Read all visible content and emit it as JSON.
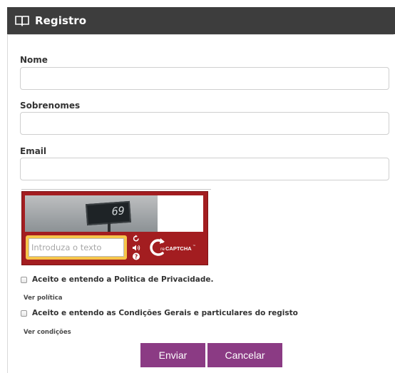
{
  "header": {
    "title": "Registro",
    "icon": "book-icon"
  },
  "form": {
    "nome_label": "Nome",
    "nome_value": "",
    "sobrenomes_label": "Sobrenomes",
    "sobrenomes_value": "",
    "email_label": "Email",
    "email_value": ""
  },
  "captcha": {
    "challenge_text": "69",
    "placeholder": "Introduza o texto",
    "value": "",
    "logo_text": "CAPTCHA",
    "logo_prefix": "re",
    "logo_tm": "™",
    "tools": [
      "refresh-icon",
      "audio-icon",
      "help-icon"
    ],
    "brand_color": "#a31d20",
    "input_frame_color": "#f6c54a"
  },
  "agreements": [
    {
      "label": "Aceito e entendo a Politica de Privacidade.",
      "checked": false,
      "link": "Ver política"
    },
    {
      "label": "Aceito e entendo as Condições Gerais e particulares do registo",
      "checked": false,
      "link": "Ver condições"
    }
  ],
  "actions": {
    "submit_label": "Enviar",
    "cancel_label": "Cancelar",
    "button_color": "#8b3b84"
  }
}
